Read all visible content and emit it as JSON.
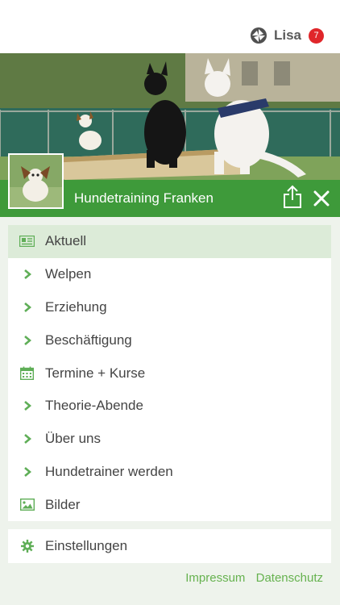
{
  "header": {
    "user_name": "Lisa",
    "notification_count": "7"
  },
  "site": {
    "title": "Hundetraining Franken"
  },
  "menu": {
    "items": [
      {
        "label": "Aktuell",
        "icon": "newspaper-icon",
        "active": true
      },
      {
        "label": "Welpen",
        "icon": "chevron-right-icon"
      },
      {
        "label": "Erziehung",
        "icon": "chevron-right-icon"
      },
      {
        "label": "Beschäftigung",
        "icon": "chevron-right-icon"
      },
      {
        "label": "Termine + Kurse",
        "icon": "calendar-icon"
      },
      {
        "label": "Theorie-Abende",
        "icon": "chevron-right-icon"
      },
      {
        "label": "Über uns",
        "icon": "chevron-right-icon"
      },
      {
        "label": "Hundetrainer werden",
        "icon": "chevron-right-icon"
      },
      {
        "label": "Bilder",
        "icon": "image-icon"
      }
    ],
    "settings_label": "Einstellungen"
  },
  "footer": {
    "impressum": "Impressum",
    "datenschutz": "Datenschutz"
  },
  "colors": {
    "brand_green": "#3e9a3a",
    "icon_green": "#5fae57",
    "active_bg": "#dcebd8",
    "badge_red": "#e0262a",
    "link_green": "#66b24f"
  }
}
